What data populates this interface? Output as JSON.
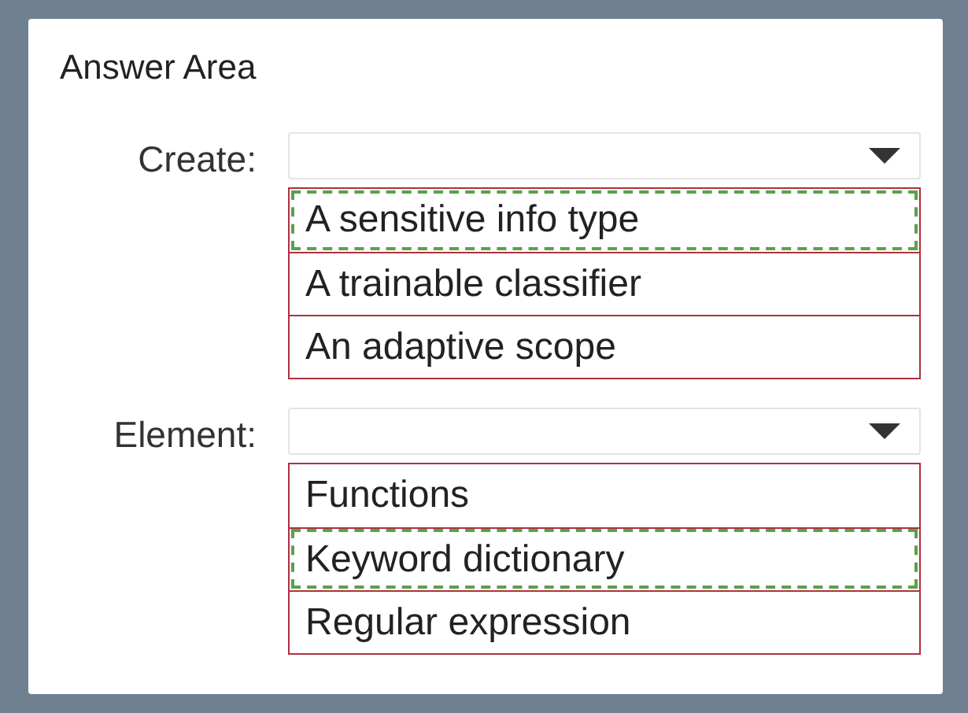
{
  "title": "Answer Area",
  "questions": [
    {
      "label": "Create:",
      "options": [
        {
          "text": "A sensitive info type",
          "selected": true
        },
        {
          "text": "A trainable classifier",
          "selected": false
        },
        {
          "text": "An adaptive scope",
          "selected": false
        }
      ]
    },
    {
      "label": "Element:",
      "options": [
        {
          "text": "Functions",
          "selected": false
        },
        {
          "text": "Keyword dictionary",
          "selected": true
        },
        {
          "text": "Regular expression",
          "selected": false
        }
      ]
    }
  ]
}
